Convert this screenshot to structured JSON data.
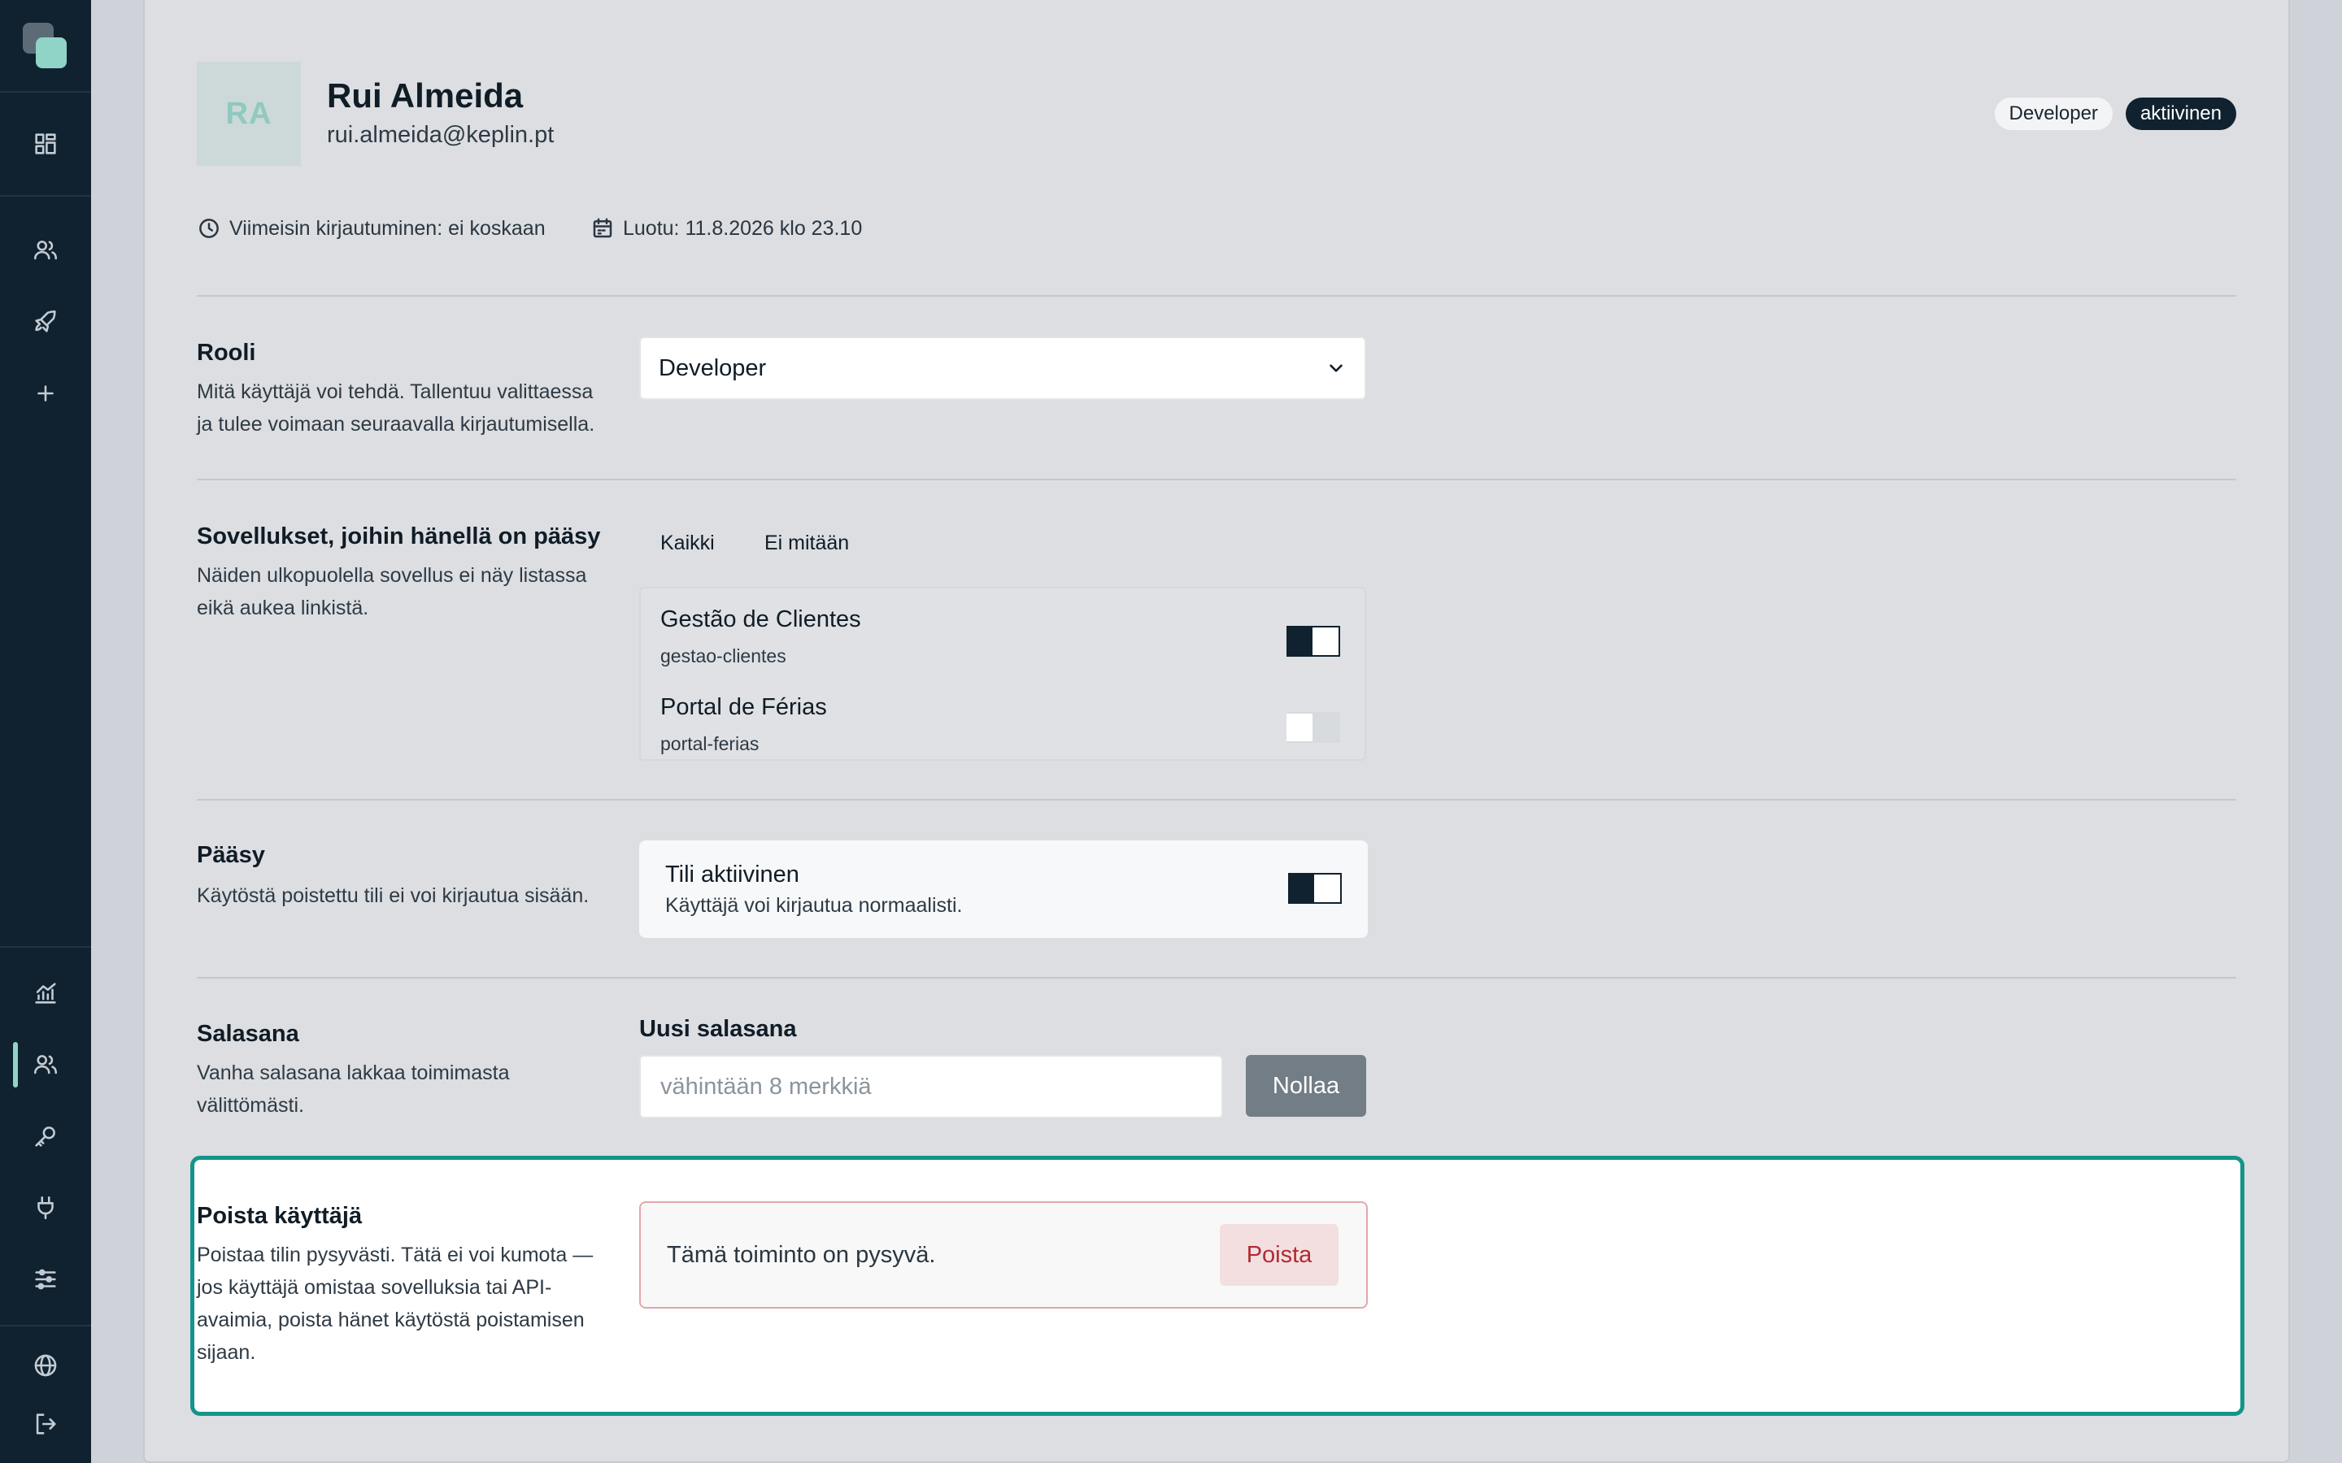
{
  "sidebar": {
    "icons": [
      "dashboard-icon",
      "users-icon",
      "rocket-icon",
      "plus-icon",
      "analytics-icon",
      "users-icon",
      "key-icon",
      "plug-icon",
      "sliders-icon",
      "globe-icon",
      "logout-icon"
    ],
    "active_item": "users",
    "accent_color": "#8fd4c6"
  },
  "user": {
    "initials": "RA",
    "name": "Rui Almeida",
    "email": "rui.almeida@keplin.pt",
    "role_badge": "Developer",
    "status_badge": "aktiivinen",
    "last_login": "Viimeisin kirjautuminen: ei koskaan",
    "created": "Luotu: 11.8.2026 klo 23.10"
  },
  "role_section": {
    "title": "Rooli",
    "description": "Mitä käyttäjä voi tehdä. Tallentuu valittaessa ja tulee voimaan seuraavalla kirjautumisella.",
    "selected": "Developer"
  },
  "apps_section": {
    "title": "Sovellukset, joihin hänellä on pääsy",
    "description": "Näiden ulkopuolella sovellus ei näy listassa eikä aukea linkistä.",
    "select_all": "Kaikki",
    "select_none": "Ei mitään",
    "apps": [
      {
        "name": "Gestão de Clientes",
        "slug": "gestao-clientes",
        "enabled": true
      },
      {
        "name": "Portal de Férias",
        "slug": "portal-ferias",
        "enabled": false
      }
    ]
  },
  "access_section": {
    "title": "Pääsy",
    "description": "Käytöstä poistettu tili ei voi kirjautua sisään.",
    "toggle_title": "Tili aktiivinen",
    "toggle_desc": "Käyttäjä voi kirjautua normaalisti.",
    "enabled": true
  },
  "password_section": {
    "title": "Salasana",
    "description": "Vanha salasana lakkaa toimimasta välittömästi.",
    "field_label": "Uusi salasana",
    "placeholder": "vähintään 8 merkkiä",
    "reset_label": "Nollaa"
  },
  "delete_section": {
    "title": "Poista käyttäjä",
    "description": "Poistaa tilin pysyvästi. Tätä ei voi kumota — jos käyttäjä omistaa sovelluksia tai API-avaimia, poista hänet käytöstä poistamisen sijaan.",
    "warning": "Tämä toiminto on pysyvä.",
    "delete_label": "Poista",
    "highlight_color": "#14948a"
  }
}
